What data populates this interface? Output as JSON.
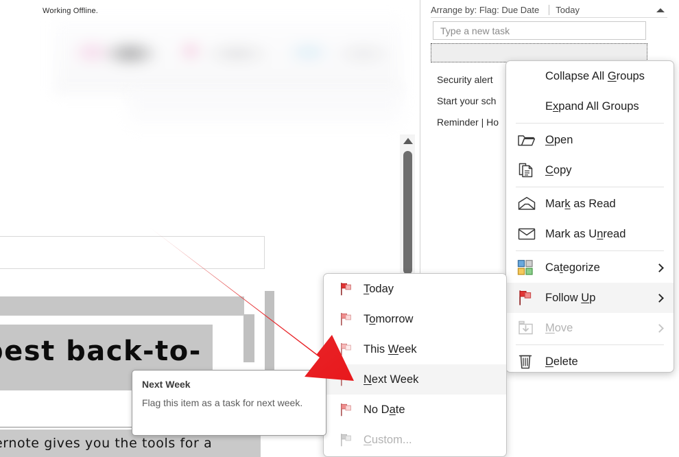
{
  "document": {
    "status_text": "Working Offline.",
    "heading": "best back-to-",
    "body_text": "ernote gives you the tools for a"
  },
  "task_pane": {
    "arrange_label": "Arrange by: Flag: Due Date",
    "arrange_group": "Today",
    "collapse_caret_icon": "caret-up-icon",
    "new_task_placeholder": "Type a new task",
    "new_task_value": "",
    "items": [
      "Security alert",
      "Start your sch",
      "Reminder | Ho"
    ]
  },
  "context_menu": {
    "items": [
      {
        "label": "Collapse All Groups",
        "icon": "",
        "accel": "G",
        "submenu": false,
        "disabled": false,
        "highlight": false,
        "sep_after": false
      },
      {
        "label": "Expand All Groups",
        "icon": "",
        "accel": "x",
        "submenu": false,
        "disabled": false,
        "highlight": false,
        "sep_after": true
      },
      {
        "label": "Open",
        "icon": "open-folder-icon",
        "accel": "O",
        "submenu": false,
        "disabled": false,
        "highlight": false,
        "sep_after": false
      },
      {
        "label": "Copy",
        "icon": "copy-icon",
        "accel": "C",
        "submenu": false,
        "disabled": false,
        "highlight": false,
        "sep_after": true
      },
      {
        "label": "Mark as Read",
        "icon": "envelope-open-icon",
        "accel": "k",
        "submenu": false,
        "disabled": false,
        "highlight": false,
        "sep_after": false
      },
      {
        "label": "Mark as Unread",
        "icon": "envelope-closed-icon",
        "accel": "U",
        "submenu": false,
        "disabled": false,
        "highlight": false,
        "sep_after": false
      },
      {
        "label": "Categorize",
        "icon": "categorize-icon",
        "accel": "t",
        "submenu": true,
        "disabled": false,
        "highlight": false,
        "sep_after": false
      },
      {
        "label": "Follow Up",
        "icon": "red-flag-icon",
        "accel": "U",
        "submenu": true,
        "disabled": false,
        "highlight": true,
        "sep_after": false
      },
      {
        "label": "Move",
        "icon": "move-to-folder-icon",
        "accel": "M",
        "submenu": true,
        "disabled": true,
        "highlight": false,
        "sep_after": true
      },
      {
        "label": "Delete",
        "icon": "trash-icon",
        "accel": "D",
        "submenu": false,
        "disabled": false,
        "highlight": false,
        "sep_after": false
      }
    ]
  },
  "follow_up_submenu": {
    "items": [
      {
        "label": "Today",
        "icon": "red-flag-icon",
        "disabled": false,
        "highlight": false
      },
      {
        "label": "Tomorrow",
        "icon": "pink-flag-icon",
        "disabled": false,
        "highlight": false
      },
      {
        "label": "This Week",
        "icon": "light-flag-icon",
        "disabled": false,
        "highlight": false
      },
      {
        "label": "Next Week",
        "icon": "light-flag-icon",
        "disabled": false,
        "highlight": true
      },
      {
        "label": "No Date",
        "icon": "pink-flag-icon",
        "disabled": false,
        "highlight": false
      },
      {
        "label": "Custom...",
        "icon": "gray-flag-icon",
        "disabled": true,
        "highlight": false
      }
    ]
  },
  "tooltip": {
    "title": "Next Week",
    "body": "Flag this item as a task for next week."
  },
  "annotation": {
    "arrow_icon": "red-arrow-icon",
    "arrow_color": "#E8262A"
  },
  "scrollbar": {
    "up_arrow_icon": "scroll-up-arrow-icon"
  },
  "colors": {
    "highlight": "#f4f4f4",
    "menu_border": "#c4c4c4",
    "flag_red": "#E02C2C",
    "flag_pink": "#F2A3A3",
    "accent_red": "#E8262A",
    "doc_gray": "#c6c6c6"
  }
}
